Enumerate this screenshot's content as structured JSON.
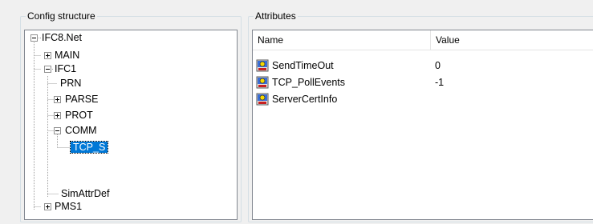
{
  "config_structure": {
    "title": "Config structure",
    "tree": [
      {
        "label": "IFC8.Net",
        "expander": "minus"
      },
      {
        "label": "MAIN",
        "expander": "plus"
      },
      {
        "label": "IFC1",
        "expander": "minus"
      },
      {
        "label": "PRN",
        "expander": "none"
      },
      {
        "label": "PARSE",
        "expander": "plus"
      },
      {
        "label": "PROT",
        "expander": "plus"
      },
      {
        "label": "COMM",
        "expander": "minus"
      },
      {
        "label": "TCP_S",
        "expander": "none",
        "selected": true
      },
      {
        "label": "SimAttrDef",
        "expander": "none"
      },
      {
        "label": "PMS1",
        "expander": "plus"
      }
    ]
  },
  "attributes": {
    "title": "Attributes",
    "columns": {
      "name": "Name",
      "value": "Value"
    },
    "rows": [
      {
        "name": "SendTimeOut",
        "value": "0",
        "icon": "attribute-icon"
      },
      {
        "name": "TCP_PollEvents",
        "value": "-1",
        "icon": "attribute-icon"
      },
      {
        "name": "ServerCertInfo",
        "value": "",
        "icon": "attribute-icon"
      }
    ]
  },
  "colors": {
    "selection": "#0078d7",
    "border": "#828790",
    "groupbox": "#d5dfe5"
  }
}
